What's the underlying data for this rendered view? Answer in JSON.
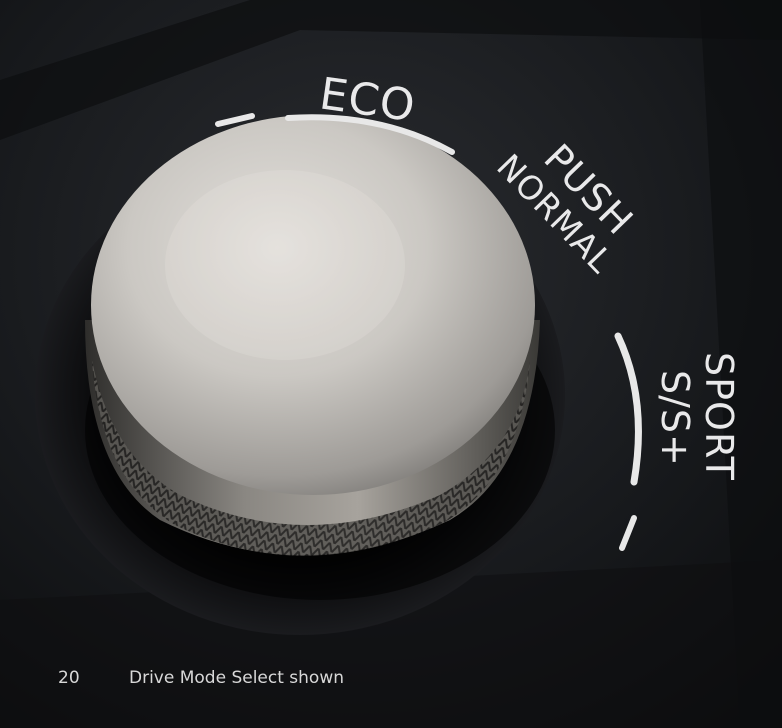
{
  "photo": {
    "subject": "drive-mode-select-dial",
    "dial_labels": {
      "eco": "ECO",
      "push": "PUSH",
      "normal": "NORMAL",
      "sport": "SPORT",
      "sport_modes": "S/S+"
    }
  },
  "caption": {
    "page_number": "20",
    "text": "Drive Mode Select shown"
  },
  "colors": {
    "background": "#0b0c0e",
    "panel": "#1b1d20",
    "label": "#e9e9ea",
    "knob": "#c9c6c2"
  }
}
